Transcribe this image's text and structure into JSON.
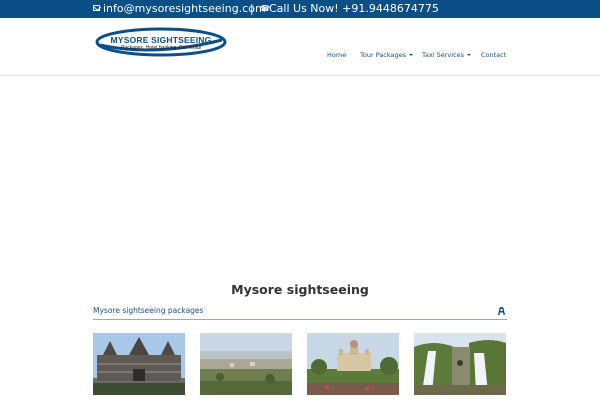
{
  "topbar": {
    "email": "info@mysoresightseeing.com",
    "separator": "|",
    "phone": "Call Us Now! +91.9448674775",
    "background": "#0b4f86",
    "icons": [
      "mail-icon",
      "phone-icon"
    ]
  },
  "logo": {
    "title": "MYSORE SIGHTSEEING",
    "subtitle": "Packages, Hotel booking, Car rental"
  },
  "nav": {
    "home": "Home",
    "tour_packages": "Tour Packages",
    "taxi_services": "Taxi Services",
    "contact": "Contact"
  },
  "main": {
    "title": "Mysore sightseeing",
    "section_title": "Mysore sightseeing packages",
    "section_icon": "car-icon",
    "thumbnails": [
      {
        "subject": "stone temple"
      },
      {
        "subject": "city view"
      },
      {
        "subject": "palace"
      },
      {
        "subject": "waterfalls"
      }
    ]
  },
  "colors": {
    "brand": "#0b4f86",
    "link": "#1c4e7a"
  }
}
